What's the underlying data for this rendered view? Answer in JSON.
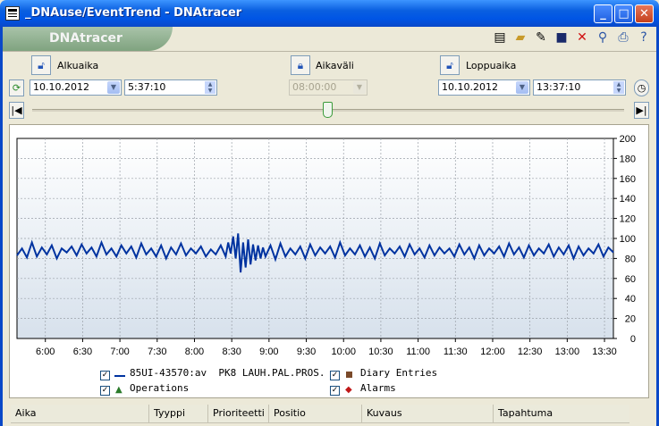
{
  "window": {
    "title": "_DNAuse/EventTrend - DNAtracer",
    "minimize": "_",
    "maximize": "□",
    "close": "✕"
  },
  "brand": "DNAtracer",
  "toolbar": {
    "icons": [
      "new-icon",
      "open-icon",
      "save-as-icon",
      "save-icon",
      "delete-icon",
      "find-icon",
      "print-icon",
      "help-icon"
    ]
  },
  "start": {
    "label": "Alkuaika",
    "date": "10.10.2012",
    "time": "5:37:10"
  },
  "interval": {
    "label": "Aikaväli",
    "value": "08:00:00"
  },
  "end": {
    "label": "Loppuaika",
    "date": "10.10.2012",
    "time": "13:37:10"
  },
  "chart_data": {
    "type": "line",
    "x_ticks": [
      "6:00",
      "6:30",
      "7:00",
      "7:30",
      "8:00",
      "8:30",
      "9:00",
      "9:30",
      "10:00",
      "10:30",
      "11:00",
      "11:30",
      "12:00",
      "12:30",
      "13:00",
      "13:30"
    ],
    "y_ticks": [
      "0",
      "20",
      "40",
      "60",
      "80",
      "100",
      "120",
      "140",
      "160",
      "180",
      "200"
    ],
    "ylim": [
      0,
      200
    ],
    "xlim": [
      "5:37:10",
      "13:37:10"
    ],
    "grid": true,
    "series": [
      {
        "name": "85UI-43570:av  PK8 LAUH.PAL.PROS.",
        "color": "#0033a0",
        "x_minutes": [
          0,
          4,
          8,
          12,
          16,
          20,
          24,
          28,
          32,
          36,
          40,
          44,
          48,
          52,
          56,
          60,
          64,
          68,
          72,
          76,
          80,
          84,
          88,
          92,
          96,
          100,
          104,
          108,
          112,
          116,
          120,
          124,
          128,
          132,
          136,
          140,
          144,
          148,
          152,
          156,
          160,
          164,
          168,
          170,
          172,
          174,
          176,
          178,
          180,
          182,
          184,
          186,
          188,
          190,
          192,
          194,
          196,
          198,
          200,
          204,
          208,
          212,
          216,
          220,
          224,
          228,
          232,
          236,
          240,
          244,
          248,
          252,
          256,
          260,
          264,
          268,
          272,
          276,
          280,
          284,
          288,
          292,
          296,
          300,
          304,
          308,
          312,
          316,
          320,
          324,
          328,
          332,
          336,
          340,
          344,
          348,
          352,
          356,
          360,
          364,
          368,
          372,
          376,
          380,
          384,
          388,
          392,
          396,
          400,
          404,
          408,
          412,
          416,
          420,
          424,
          428,
          432,
          436,
          440,
          444,
          448,
          452,
          456,
          460,
          464,
          468,
          472,
          476,
          480
        ],
        "values": [
          83,
          90,
          81,
          96,
          82,
          91,
          84,
          93,
          80,
          90,
          86,
          92,
          83,
          94,
          85,
          91,
          82,
          96,
          84,
          90,
          82,
          93,
          85,
          92,
          81,
          95,
          84,
          90,
          82,
          93,
          80,
          91,
          84,
          95,
          83,
          90,
          85,
          92,
          82,
          89,
          84,
          93,
          82,
          96,
          85,
          102,
          80,
          105,
          66,
          96,
          71,
          99,
          74,
          94,
          78,
          93,
          80,
          91,
          82,
          93,
          79,
          95,
          82,
          90,
          84,
          92,
          80,
          94,
          83,
          91,
          85,
          92,
          81,
          96,
          83,
          90,
          84,
          93,
          82,
          91,
          80,
          95,
          83,
          90,
          85,
          92,
          82,
          94,
          84,
          90,
          81,
          93,
          83,
          91,
          85,
          90,
          82,
          94,
          84,
          91,
          80,
          93,
          83,
          90,
          85,
          92,
          82,
          95,
          84,
          91,
          81,
          93,
          83,
          90,
          85,
          94,
          82,
          91,
          84,
          93,
          80,
          92,
          83,
          90,
          85,
          94,
          82,
          91,
          86
        ]
      }
    ]
  },
  "legend": {
    "series_name": "85UI-43570:av  PK8 LAUH.PAL.PROS.",
    "operations": "Operations",
    "diary": "Diary Entries",
    "alarms": "Alarms"
  },
  "table": {
    "columns": [
      "Aika",
      "Tyyppi",
      "Prioriteetti",
      "Positio",
      "Kuvaus",
      "Tapahtuma"
    ]
  }
}
